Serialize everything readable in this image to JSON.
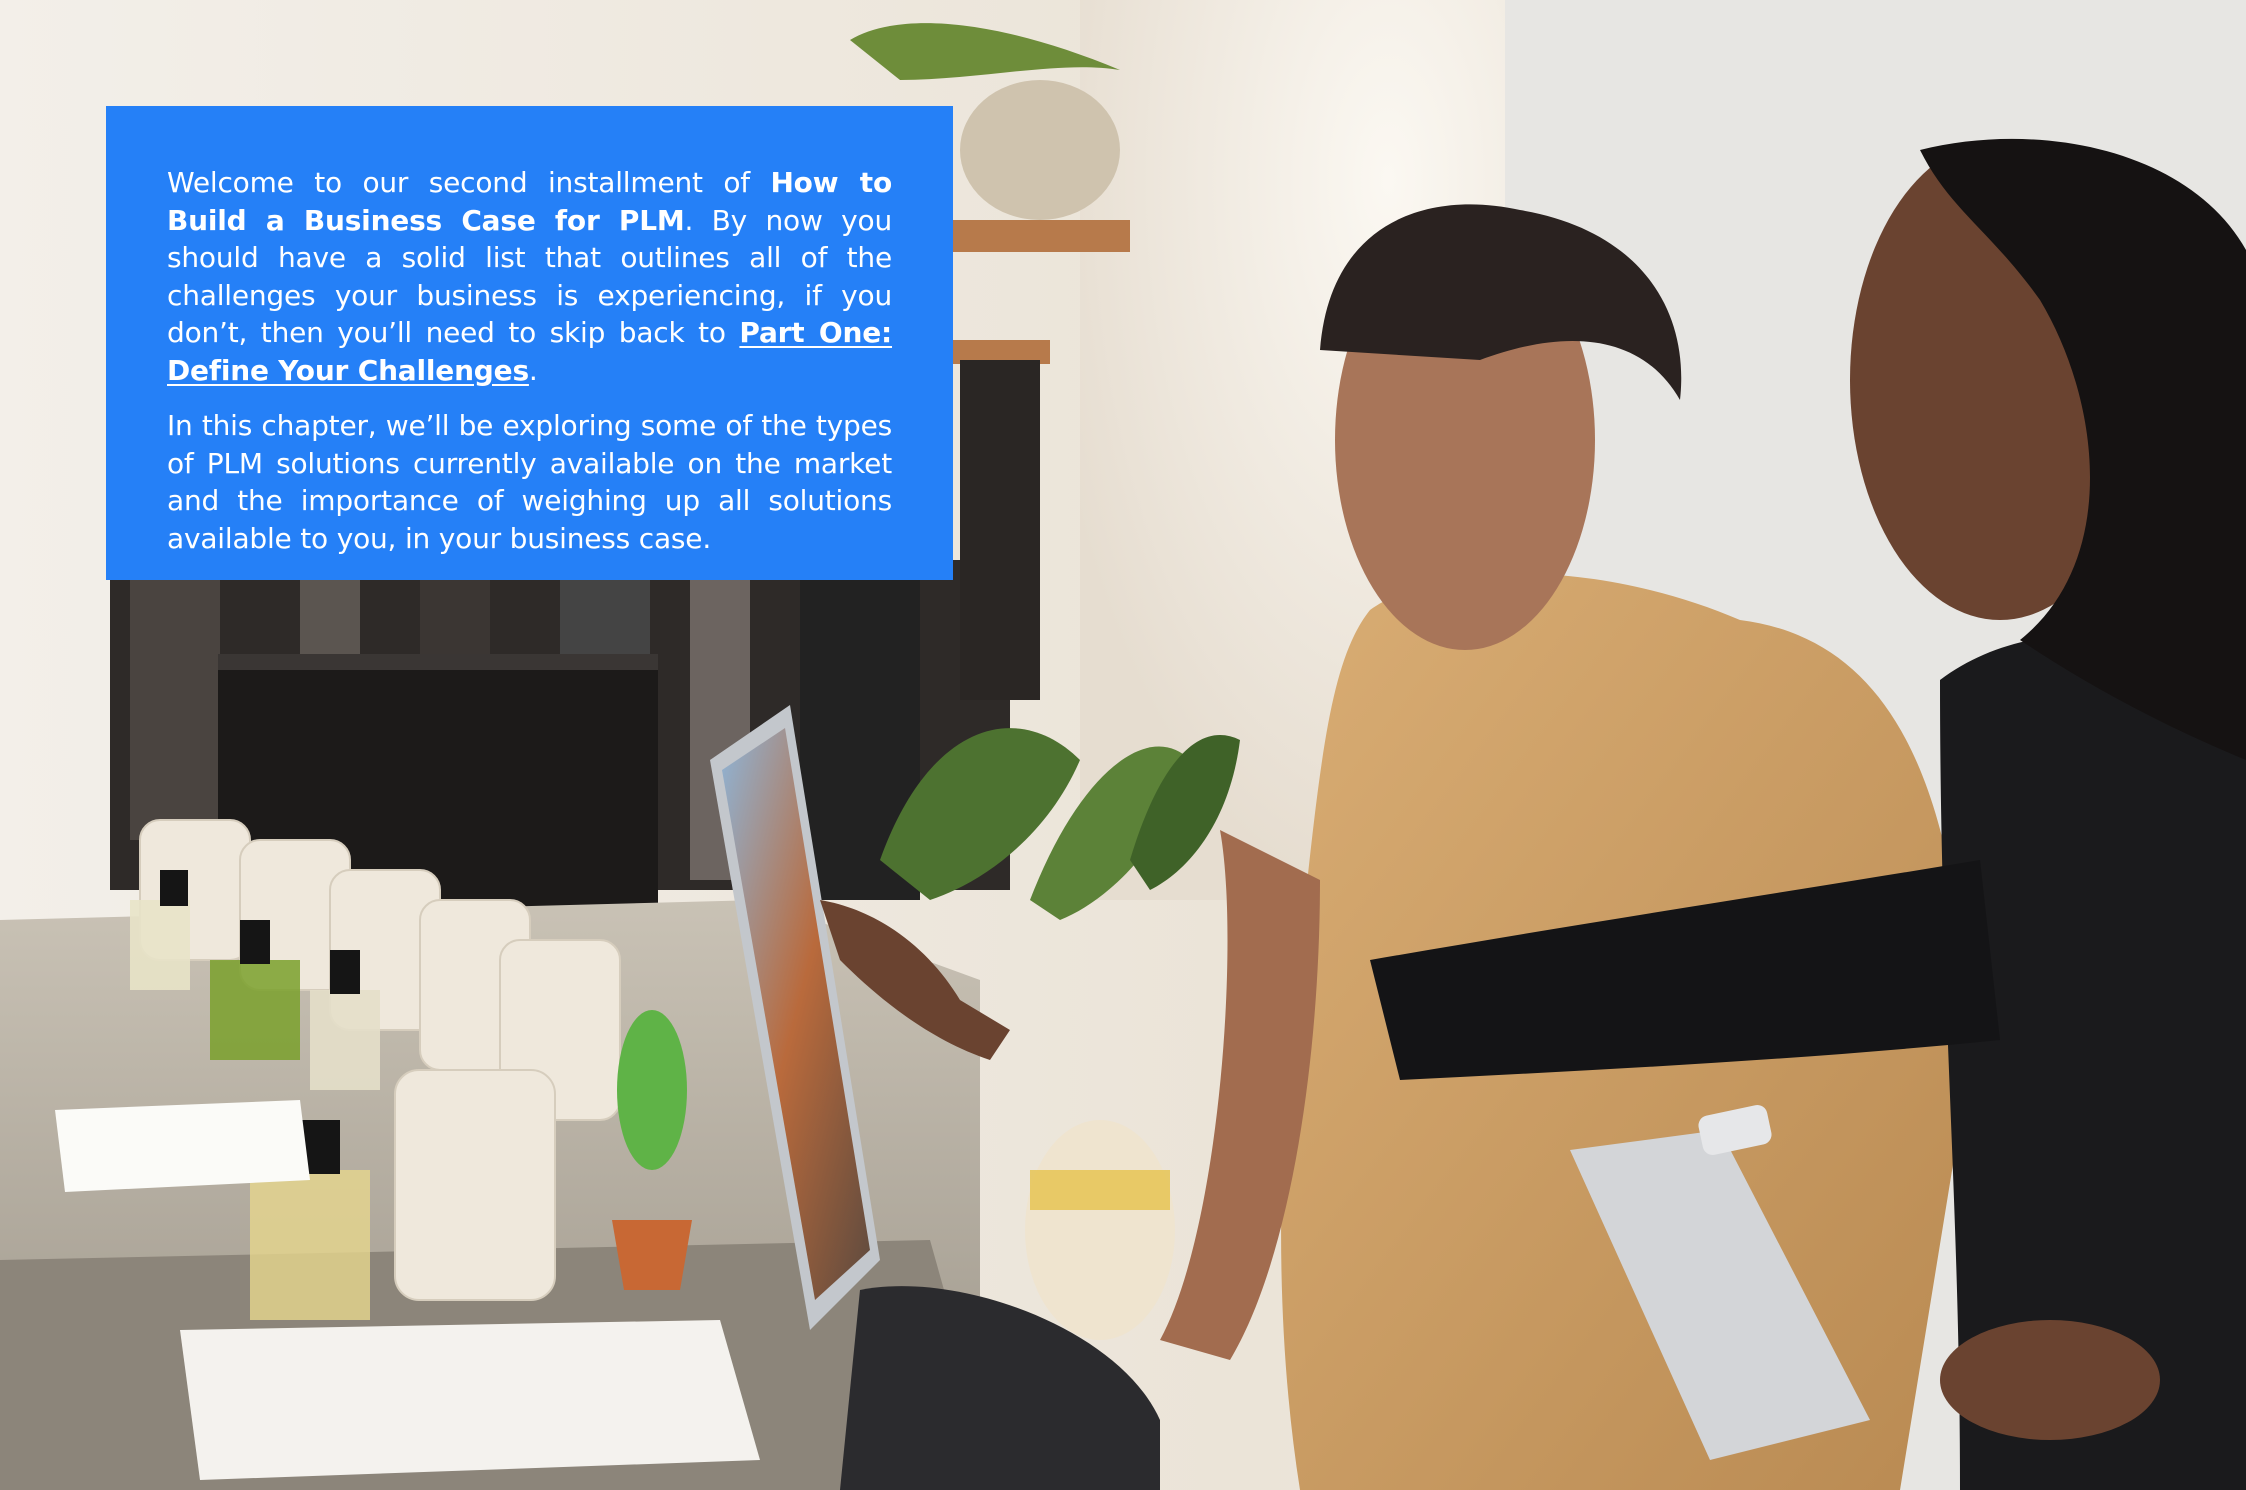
{
  "intro": {
    "p1_before": "Welcome to our second installment of ",
    "p1_bold": "How to Build a Business Case for PLM",
    "p1_middle": ". By now you should have a solid list that outlines all of the challenges your business is experiencing, if you don’t, then you’ll need to skip back to ",
    "p1_link": "Part One: Define Your Challenges",
    "p1_end": ".",
    "p2": "In this chapter, we’ll be exploring some of the types of PLM solutions currently available on the market and the importance of weighing up all solutions available to you, in your business case."
  },
  "colors": {
    "panel_blue": "#2580f7",
    "panel_text": "#ffffff"
  }
}
